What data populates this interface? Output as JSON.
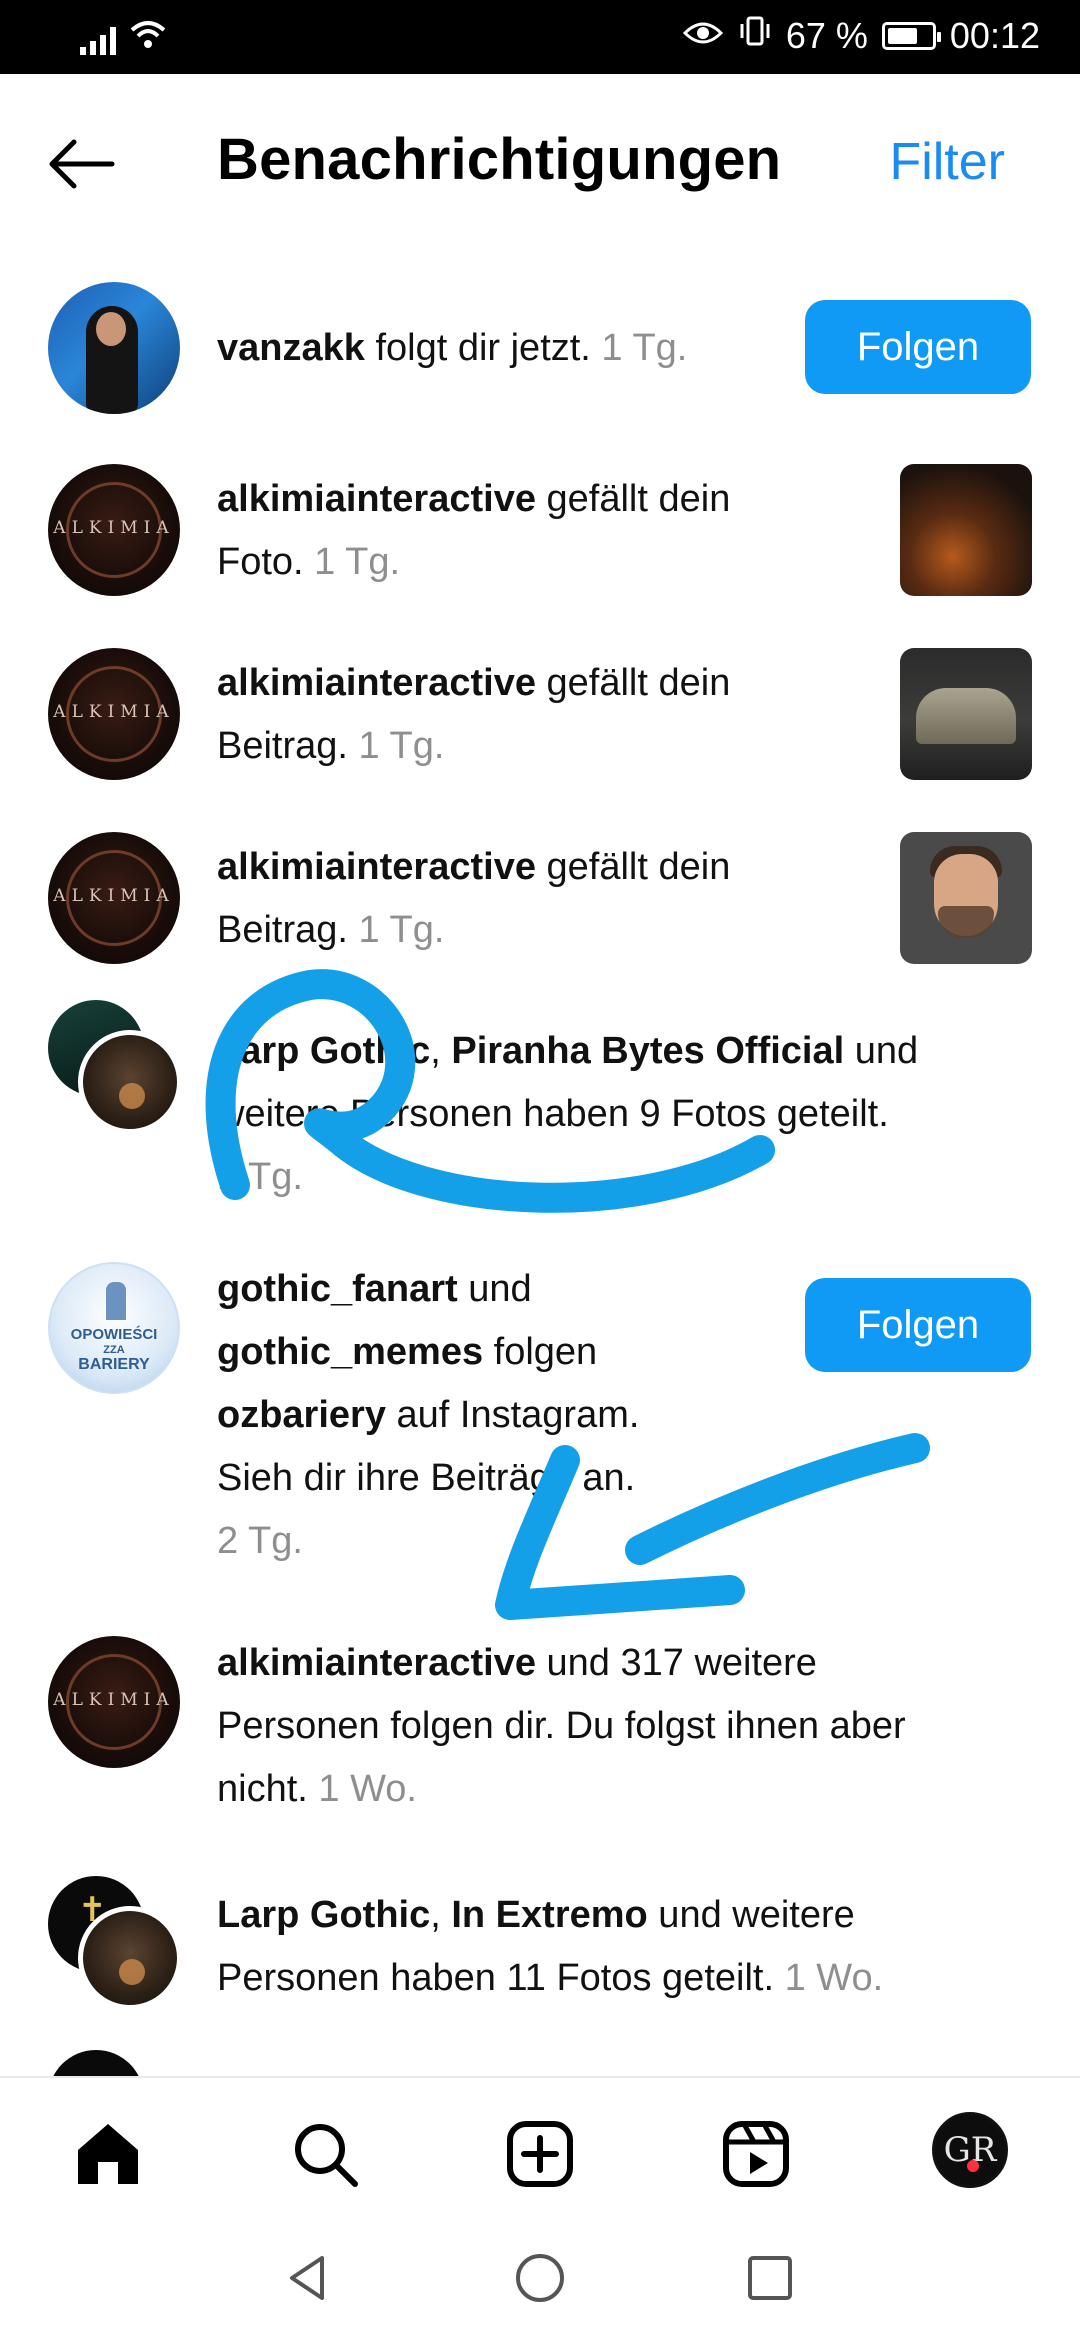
{
  "status_bar": {
    "battery": "67 %",
    "time": "00:12",
    "icons": [
      "signal-icon",
      "wifi-icon",
      "eye-icon",
      "vibrate-icon",
      "battery-icon"
    ]
  },
  "header": {
    "title": "Benachrichtigungen",
    "filter_label": "Filter",
    "back_icon": "arrow-left-icon"
  },
  "notifications": [
    {
      "user": "vanzakk",
      "text": " folgt dir jetzt.",
      "time": " 1 Tg.",
      "button": "Folgen"
    },
    {
      "user": "alkimiainteractive",
      "text_line1": " gefällt dein",
      "text_line2": "Foto.",
      "time": " 1 Tg.",
      "avatar_text": "ALKIMIA"
    },
    {
      "user": "alkimiainteractive",
      "text_line1": " gefällt dein",
      "text_line2": "Beitrag.",
      "time": " 1 Tg.",
      "avatar_text": "ALKIMIA"
    },
    {
      "user": "alkimiainteractive",
      "text_line1": " gefällt dein",
      "text_line2": "Beitrag.",
      "time": " 1 Tg.",
      "avatar_text": "ALKIMIA"
    },
    {
      "user1": "Larp Gothic",
      "user2": "Piranha Bytes Official",
      "sep": ", ",
      "text_line1": " und",
      "text_line2": "weitere Personen haben 9 Fotos geteilt.",
      "time": "1 Tg."
    },
    {
      "user1": "gothic_fanart",
      "mid1": " und",
      "user2": "gothic_memes",
      "mid2": " folgen",
      "user3": "ozbariery",
      "mid3": " auf Instagram.",
      "line4": "Sieh dir ihre Beiträge an.",
      "time": "2 Tg.",
      "button": "Folgen",
      "avatar_lines": [
        "OPOWIEŚCI",
        "ZZA",
        "BARIERY"
      ]
    },
    {
      "user": "alkimiainteractive",
      "text_line1": " und 317 weitere",
      "text_line2": "Personen folgen dir. Du folgst ihnen aber",
      "text_line3": "nicht.",
      "time": " 1 Wo.",
      "avatar_text": "ALKIMIA"
    },
    {
      "user1": "Larp Gothic",
      "sep": ", ",
      "user2": "In Extremo",
      "text_line1": " und weitere",
      "text_line2": "Personen haben 11 Fotos geteilt.",
      "time": " 1 Wo."
    }
  ],
  "bottom_nav": {
    "items": [
      "home-icon",
      "search-icon",
      "create-icon",
      "reels-icon",
      "profile-avatar"
    ],
    "profile_initials": "GR"
  },
  "system_nav": [
    "back-triangle-icon",
    "home-circle-icon",
    "recents-square-icon"
  ],
  "colors": {
    "accent": "#0f9af5",
    "filter": "#1a8cf0",
    "scribble": "#14a0e8",
    "time_grey": "#8e8e8e",
    "notif_dot": "#ff3040"
  }
}
